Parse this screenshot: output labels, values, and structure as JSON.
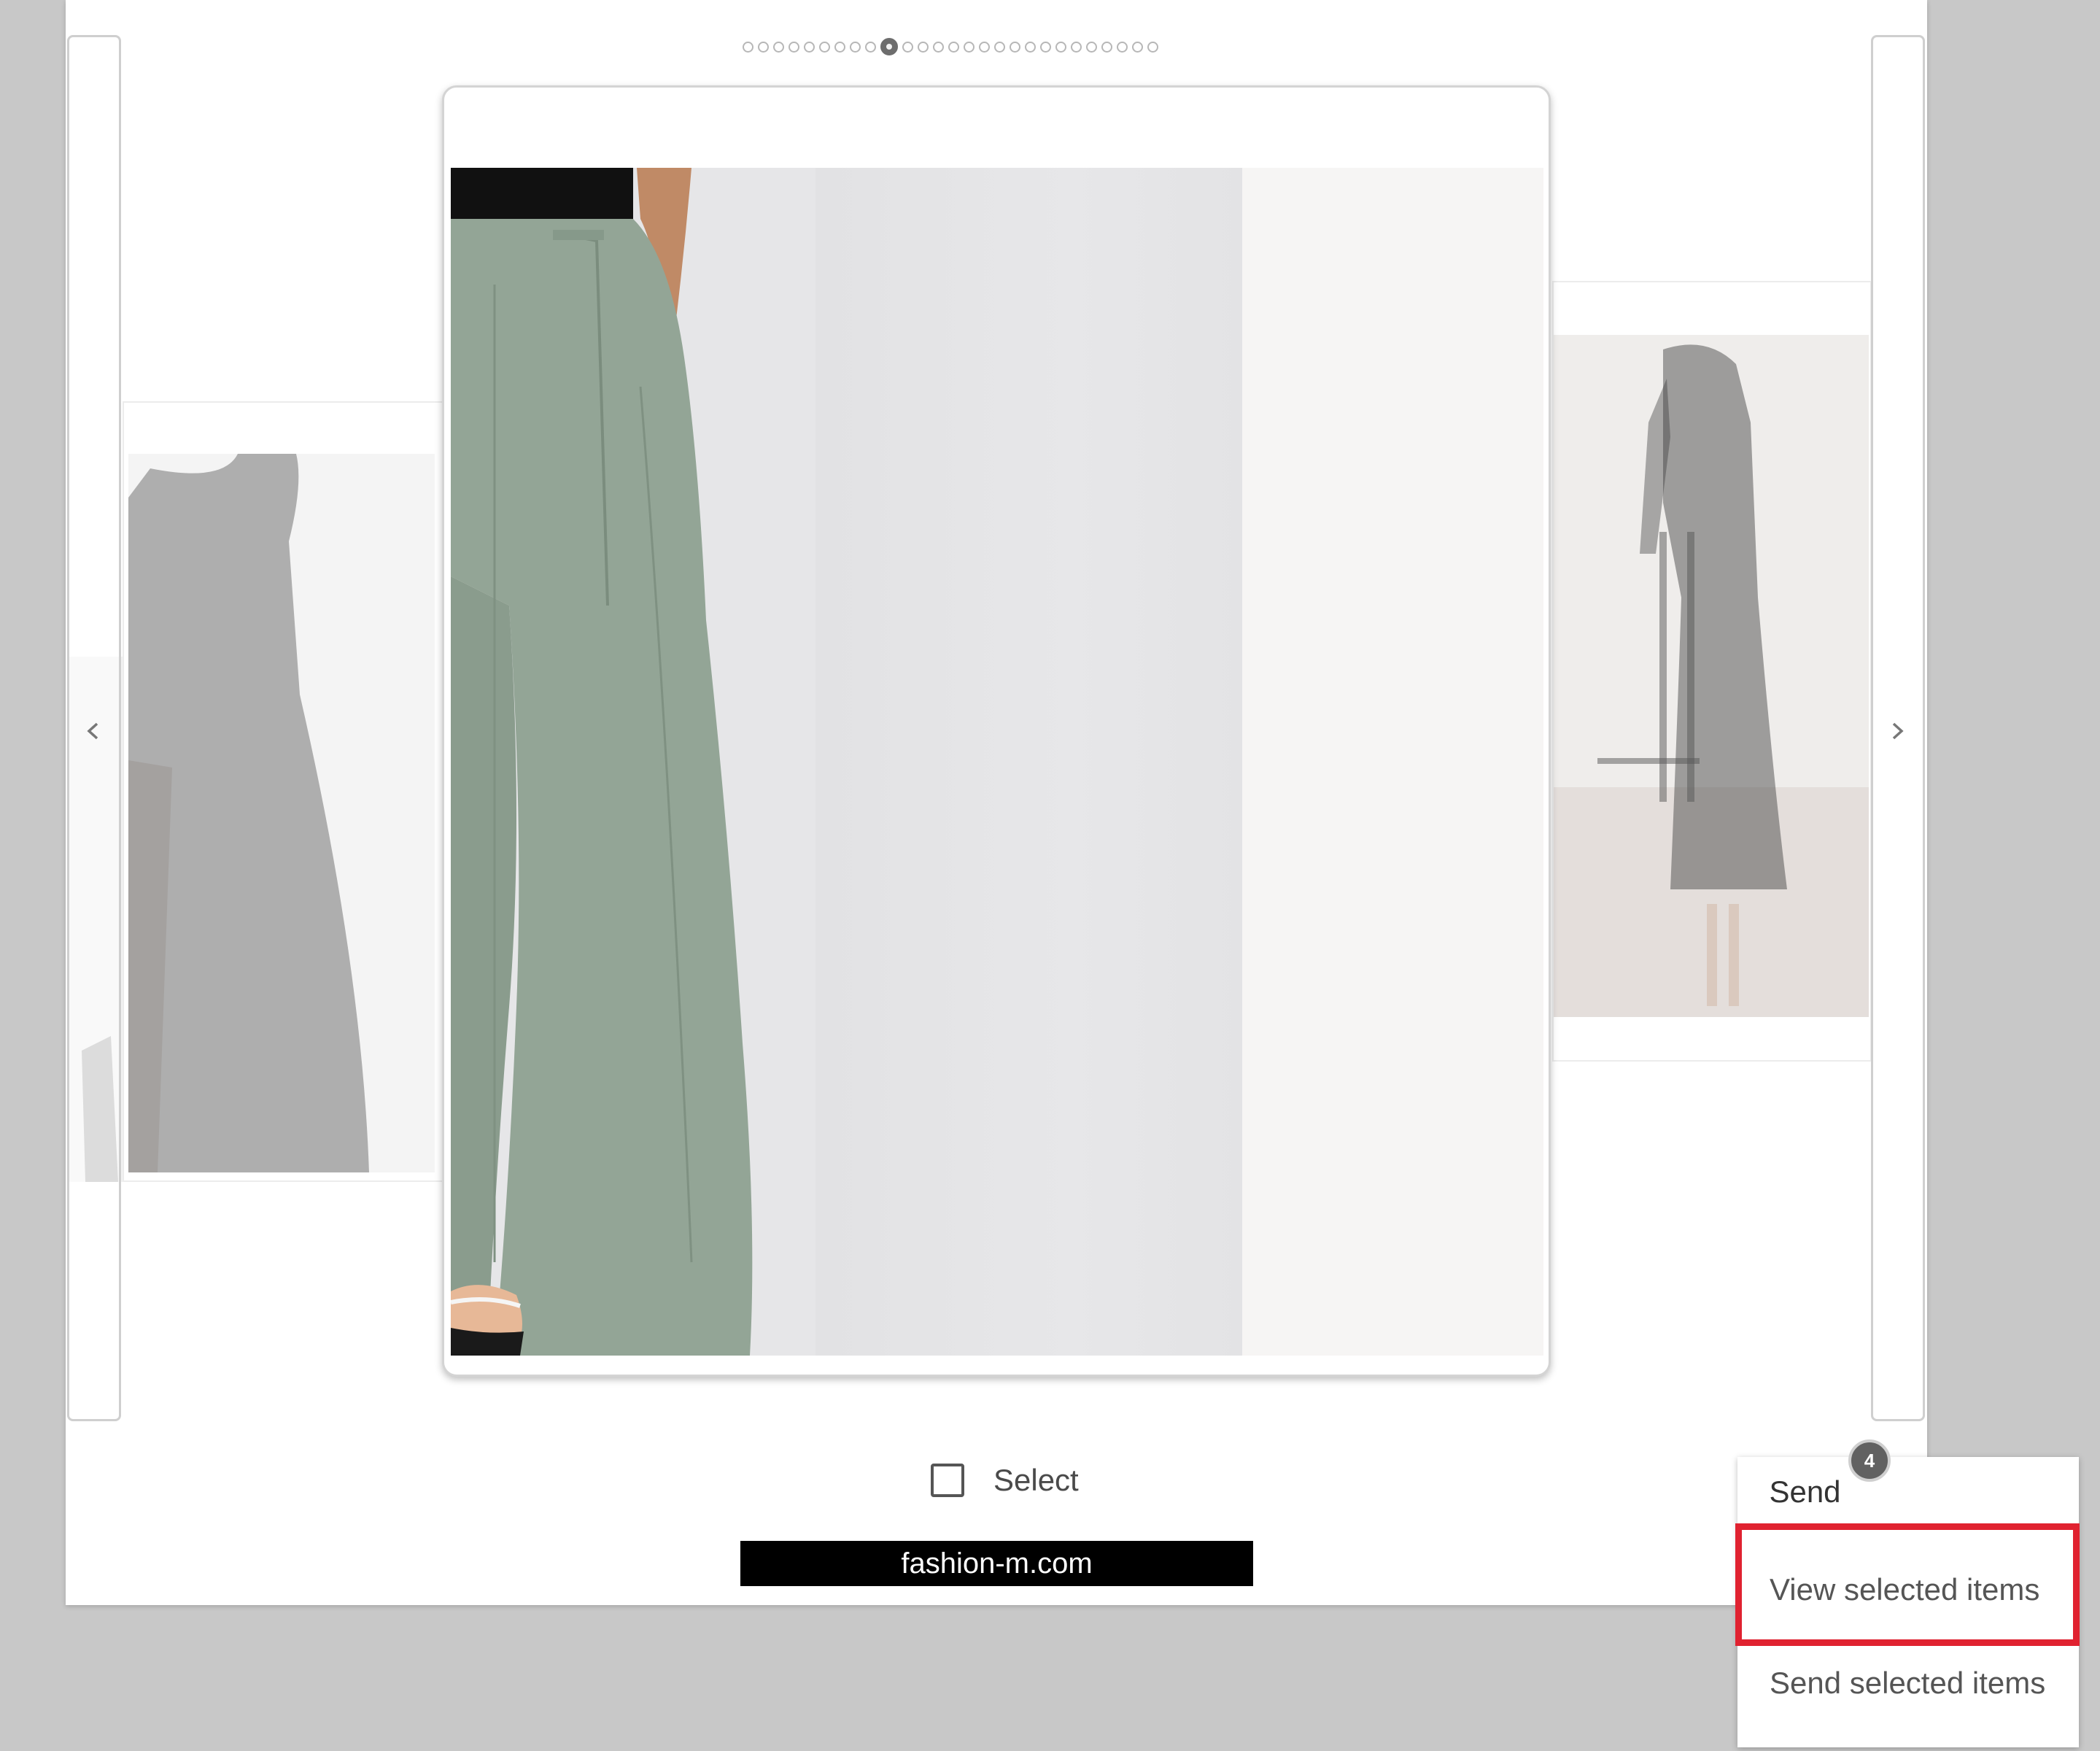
{
  "carousel": {
    "total_slides": 27,
    "active_index": 9
  },
  "select": {
    "label": "Select",
    "checked": false
  },
  "source_banner": {
    "text": "fashion-m.com"
  },
  "send_menu": {
    "send_label": "Send",
    "selected_count": "4",
    "items": [
      {
        "label": "View selected items",
        "highlighted": true
      },
      {
        "label": "Send selected items",
        "highlighted": false
      }
    ]
  },
  "icons": {
    "prev": "chevron-left-icon",
    "next": "chevron-right-icon"
  },
  "colors": {
    "page_background": "#c8c8c8",
    "highlight": "#e02230",
    "badge": "#616161",
    "trousers": "#93a596"
  }
}
